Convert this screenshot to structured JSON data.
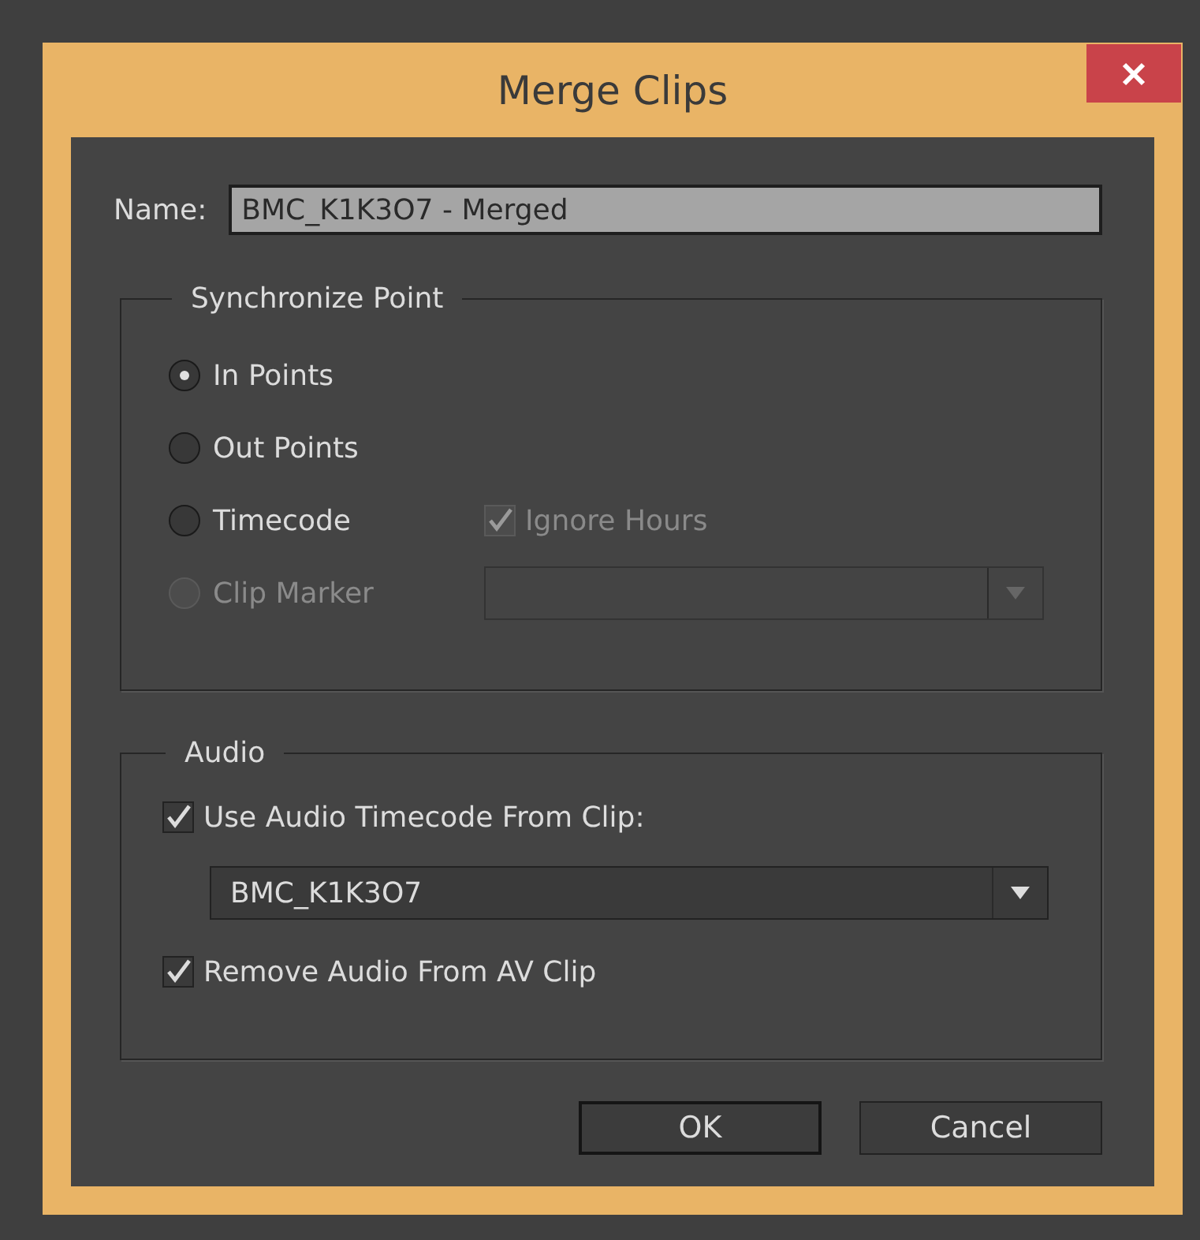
{
  "window": {
    "title": "Merge Clips"
  },
  "name_field": {
    "label": "Name:",
    "value": "BMC_K1K3O7 - Merged"
  },
  "sync_group": {
    "title": "Synchronize Point",
    "options": [
      {
        "label": "In Points",
        "selected": true,
        "disabled": false
      },
      {
        "label": "Out Points",
        "selected": false,
        "disabled": false
      },
      {
        "label": "Timecode",
        "selected": false,
        "disabled": false,
        "extra": {
          "kind": "checkbox",
          "label": "Ignore Hours",
          "checked": true,
          "disabled": true
        }
      },
      {
        "label": "Clip Marker",
        "selected": false,
        "disabled": true,
        "extra": {
          "kind": "dropdown",
          "disabled": true
        }
      }
    ]
  },
  "audio_group": {
    "title": "Audio",
    "use_timecode": {
      "label": "Use Audio Timecode From Clip:",
      "checked": true
    },
    "clip_dropdown": {
      "value": "BMC_K1K3O7"
    },
    "remove_audio": {
      "label": "Remove Audio From AV Clip",
      "checked": true
    }
  },
  "buttons": [
    {
      "label": "OK",
      "default": true
    },
    {
      "label": "Cancel",
      "default": false
    }
  ]
}
